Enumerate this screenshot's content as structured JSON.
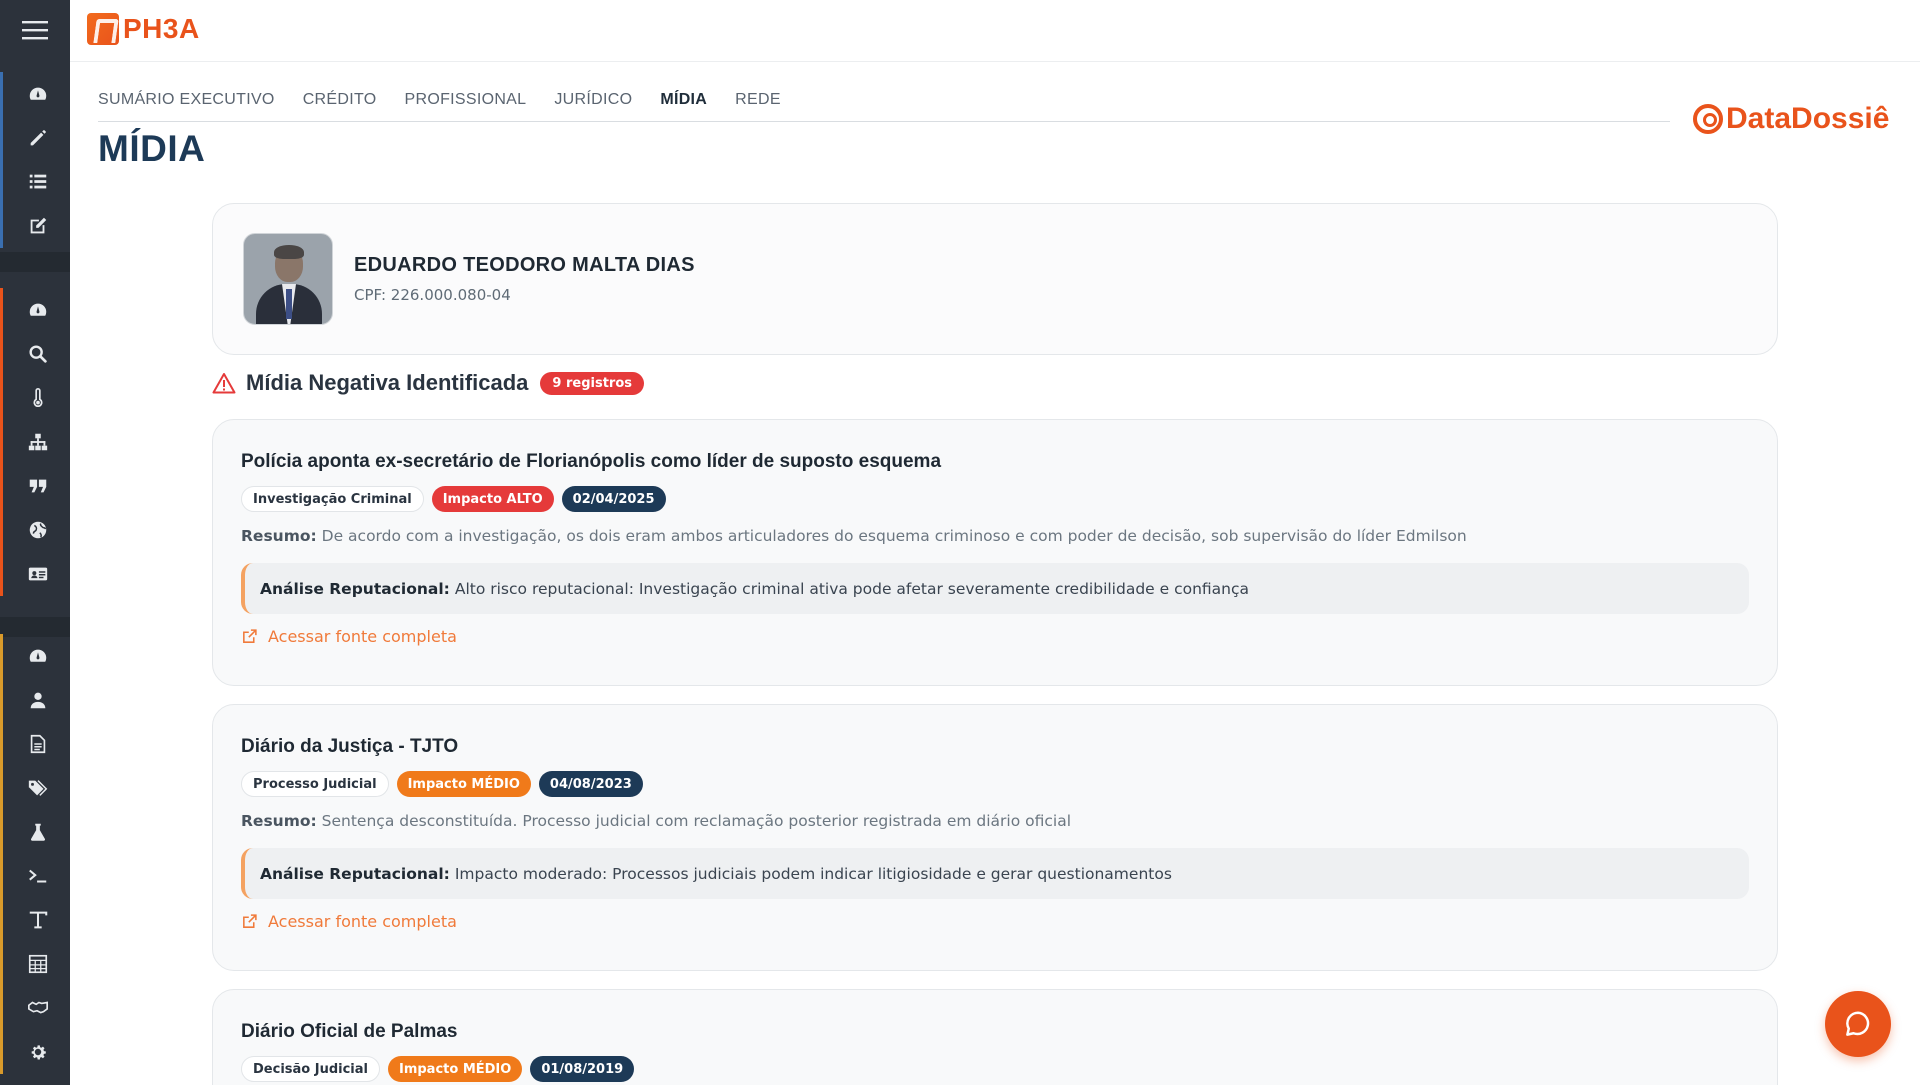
{
  "app": {
    "logo_text": "PH3A",
    "partner_logo_text": "DataDossiê"
  },
  "tabs": [
    {
      "label": "SUMÁRIO EXECUTIVO"
    },
    {
      "label": "CRÉDITO"
    },
    {
      "label": "PROFISSIONAL"
    },
    {
      "label": "JURÍDICO"
    },
    {
      "label": "MÍDIA",
      "active": true
    },
    {
      "label": "REDE"
    }
  ],
  "page": {
    "title": "MÍDIA"
  },
  "profile": {
    "name": "EDUARDO TEODORO MALTA DIAS",
    "cpf": "CPF: 226.000.080-04"
  },
  "section": {
    "title": "Mídia Negativa Identificada",
    "count_badge": "9 registros"
  },
  "labels": {
    "resumo": "Resumo:",
    "analise": "Análise Reputacional:",
    "link": "Acessar fonte completa"
  },
  "news": [
    {
      "title": "Polícia aponta ex-secretário de Florianópolis como líder de suposto esquema",
      "category": "Investigação Criminal",
      "impact": "Impacto ALTO",
      "date": "02/04/2025",
      "resumo": "De acordo com a investigação, os dois eram ambos articuladores do esquema criminoso e com poder de decisão, sob supervisão do líder Edmilson",
      "analise": "Alto risco reputacional: Investigação criminal ativa pode afetar severamente credibilidade e confiança"
    },
    {
      "title": "Diário da Justiça - TJTO",
      "category": "Processo Judicial",
      "impact": "Impacto MÉDIO",
      "date": "04/08/2023",
      "resumo": "Sentença desconstituída. Processo judicial com reclamação posterior registrada em diário oficial",
      "analise": "Impacto moderado: Processos judiciais podem indicar litigiosidade e gerar questionamentos"
    },
    {
      "title": "Diário Oficial de Palmas",
      "category": "Decisão Judicial",
      "impact": "Impacto MÉDIO",
      "date": "01/08/2019"
    }
  ],
  "colors": {
    "brand": "#e9531b",
    "navy": "#1d3a57",
    "impact_high": "#e53a3a",
    "impact_medium": "#f07a1a",
    "sidebar": "#2c323b"
  },
  "sidebar_icons": [
    "dashboard-icon",
    "pencil-icon",
    "list-icon",
    "edit-icon",
    "dashboard-icon",
    "search-icon",
    "thermometer-icon",
    "sitemap-icon",
    "quote-icon",
    "globe-icon",
    "id-card-icon",
    "dashboard-icon",
    "user-icon",
    "document-icon",
    "tags-icon",
    "flask-icon",
    "terminal-icon",
    "text-icon",
    "table-icon",
    "handshake-icon",
    "gear-icon"
  ]
}
